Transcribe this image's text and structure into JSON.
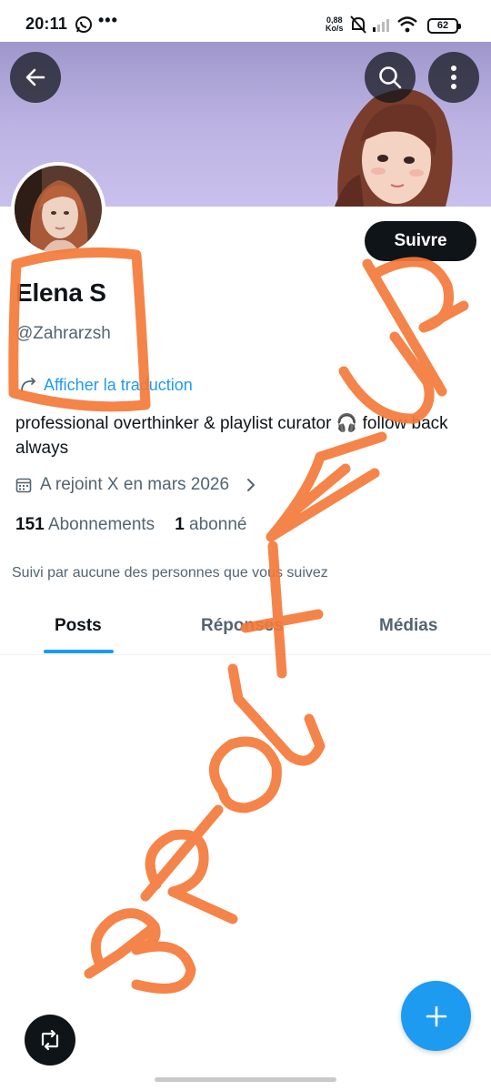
{
  "status_bar": {
    "time": "20:11",
    "dots": "•••",
    "speed_value": "0,88",
    "speed_unit": "Ko/s",
    "battery": "62",
    "icons": [
      "whatsapp-icon",
      "bell-muted-icon",
      "signal-icon",
      "wifi-icon",
      "battery-icon"
    ]
  },
  "header": {
    "back_icon": "arrow-left-icon",
    "search_icon": "search-icon",
    "more_icon": "more-vertical-icon"
  },
  "profile": {
    "name": "Elena S",
    "handle": "@Zahrarzsh",
    "translate_label": "Afficher la traduction",
    "bio": "professional overthinker & playlist curator 🎧 follow back always",
    "joined": "A rejoint X en mars 2026",
    "following_count": "151",
    "following_label": "Abonnements",
    "followers_count": "1",
    "followers_label": "abonné",
    "followed_by": "Suivi par aucune des personnes que vous suivez"
  },
  "follow_button": {
    "label": "Suivre"
  },
  "tabs": [
    {
      "label": "Posts",
      "active": true
    },
    {
      "label": "Réponses",
      "active": false
    },
    {
      "label": "Médias",
      "active": false
    }
  ],
  "overlay": {
    "scribble_text": "BROUTEUR",
    "scribble_color": "#f47a3a"
  },
  "colors": {
    "accent": "#1d9bf0",
    "text_primary": "#0f1419",
    "text_secondary": "#536471",
    "banner": "#b5acdc"
  }
}
